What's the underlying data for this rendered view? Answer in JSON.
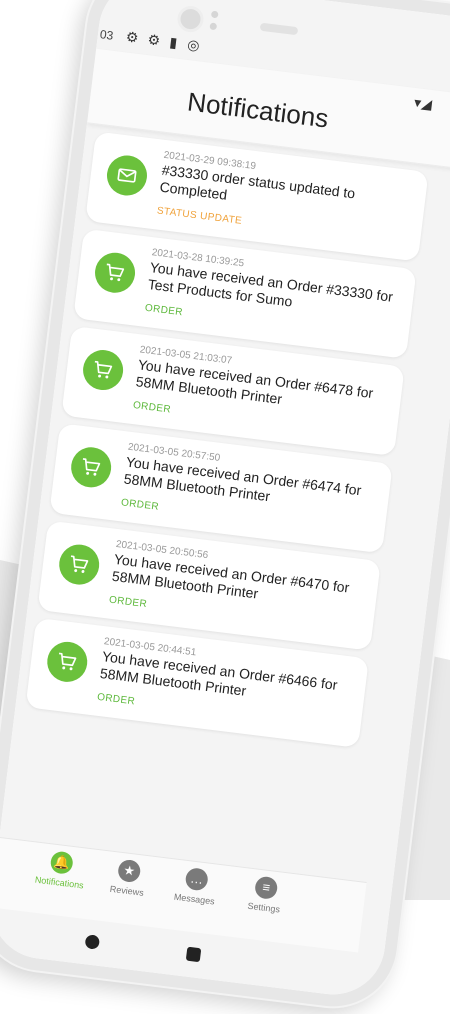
{
  "status_bar": {
    "time": "03"
  },
  "header": {
    "title": "Notifications"
  },
  "notifications": [
    {
      "datetime": "2021-03-29 09:38:19",
      "message": "#33330 order status updated to Completed",
      "type": "STATUS UPDATE",
      "icon": "envelope",
      "type_color": "#f0a23a"
    },
    {
      "datetime": "2021-03-28 10:39:25",
      "message": "You have received an Order #33330 for Test Products for Sumo",
      "type": "ORDER",
      "icon": "cart",
      "type_color": "#5cb83a"
    },
    {
      "datetime": "2021-03-05 21:03:07",
      "message": "You have received an Order #6478 for 58MM Bluetooth Printer",
      "type": "ORDER",
      "icon": "cart",
      "type_color": "#5cb83a"
    },
    {
      "datetime": "2021-03-05 20:57:50",
      "message": "You have received an Order #6474 for 58MM Bluetooth Printer",
      "type": "ORDER",
      "icon": "cart",
      "type_color": "#5cb83a"
    },
    {
      "datetime": "2021-03-05 20:50:56",
      "message": "You have received an Order #6470 for 58MM Bluetooth Printer",
      "type": "ORDER",
      "icon": "cart",
      "type_color": "#5cb83a"
    },
    {
      "datetime": "2021-03-05 20:44:51",
      "message": "You have received an Order #6466 for 58MM Bluetooth Printer",
      "type": "ORDER",
      "icon": "cart",
      "type_color": "#5cb83a"
    }
  ],
  "bottom_nav": {
    "items": [
      {
        "label": "Notifications",
        "icon": "bell",
        "active": true
      },
      {
        "label": "Reviews",
        "icon": "star",
        "active": false
      },
      {
        "label": "Messages",
        "icon": "chat",
        "active": false
      },
      {
        "label": "Settings",
        "icon": "list",
        "active": false
      }
    ]
  },
  "accent_color": "#6bc13c"
}
